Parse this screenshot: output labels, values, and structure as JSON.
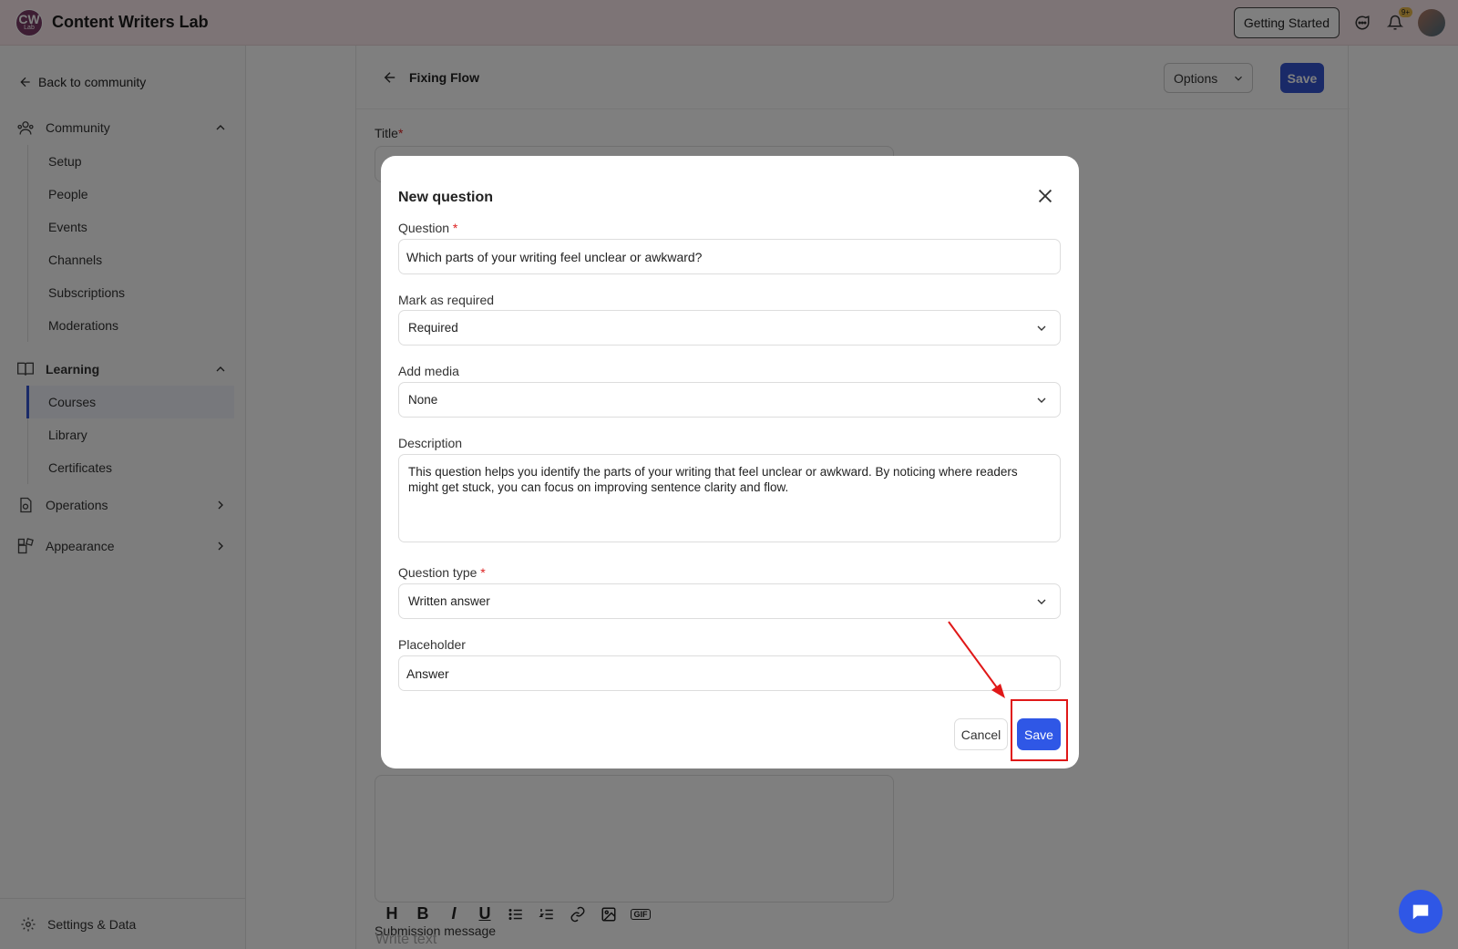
{
  "topbar": {
    "logo_text": "CW",
    "logo_sub": "Lab",
    "app_title": "Content Writers Lab",
    "getting_started": "Getting Started",
    "notification_badge": "9+"
  },
  "sidebar": {
    "back_label": "Back to community",
    "community": {
      "label": "Community",
      "items": [
        "Setup",
        "People",
        "Events",
        "Channels",
        "Subscriptions",
        "Moderations"
      ]
    },
    "learning": {
      "label": "Learning",
      "items": [
        "Courses",
        "Library",
        "Certificates"
      ],
      "active": "Courses"
    },
    "operations_label": "Operations",
    "appearance_label": "Appearance",
    "settings_label": "Settings & Data"
  },
  "main": {
    "title": "Fixing Flow",
    "options_label": "Options",
    "save_label": "Save",
    "title_field_label": "Title",
    "submission_label": "Submission message",
    "write_text_placeholder": "Write text",
    "toolbar": [
      "H",
      "B",
      "I",
      "U",
      "bullet-list",
      "numbered-list",
      "link",
      "image",
      "GIF"
    ]
  },
  "modal": {
    "heading": "New question",
    "question_label": "Question",
    "question_value": "Which parts of your writing feel unclear or awkward?",
    "required_label": "Mark as required",
    "required_value": "Required",
    "media_label": "Add media",
    "media_value": "None",
    "description_label": "Description",
    "description_value": "This question helps you identify the parts of your writing that feel unclear or awkward. By noticing where readers might get stuck, you can focus on improving sentence clarity and flow.",
    "type_label": "Question type",
    "type_value": "Written answer",
    "placeholder_label": "Placeholder",
    "placeholder_value": "Answer",
    "cancel_label": "Cancel",
    "save_label": "Save"
  },
  "colors": {
    "accent": "#2f57e6",
    "topbar_bg": "#fbe9ec",
    "annotation": "#e01818"
  }
}
